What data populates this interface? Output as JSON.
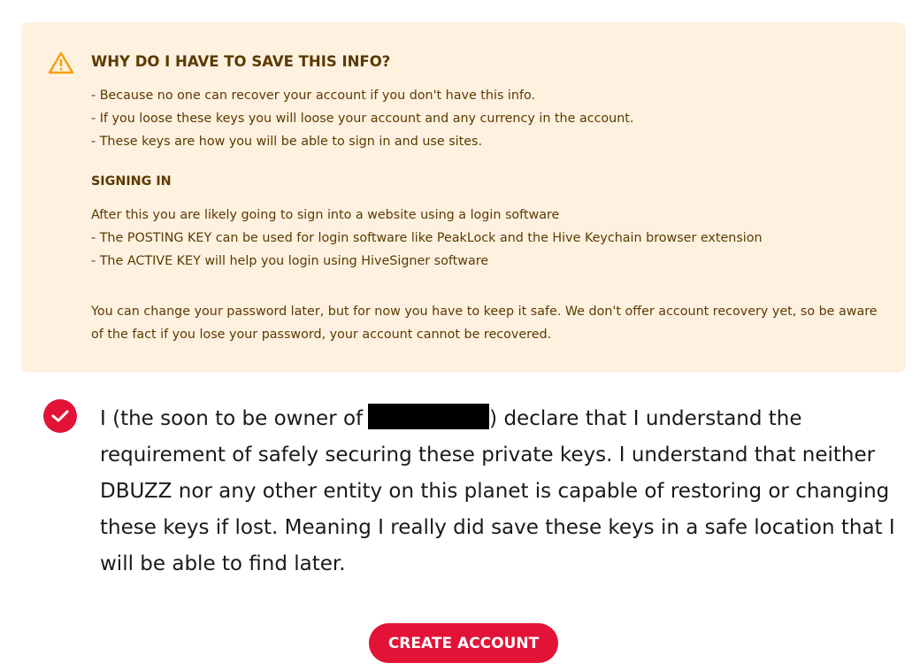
{
  "notice": {
    "title": "WHY DO I HAVE TO SAVE THIS INFO?",
    "reasons": [
      "- Because no one can recover your account if you don't have this info.",
      "- If you loose these keys you will loose your account and any currency in the account.",
      "- These keys are how you will be able to sign in and use sites."
    ],
    "signing_title": "SIGNING IN",
    "signing_lines": [
      "After this you are likely going to sign into a website using a login software",
      "- The POSTING KEY can be used for login software like PeakLock and the Hive Keychain browser extension",
      "- The ACTIVE KEY will help you login using HiveSigner software"
    ],
    "warning_paragraph": "You can change your password later, but for now you have to keep it safe. We don't offer account recovery yet, so be aware of the fact if you lose your password, your account cannot be recovered."
  },
  "declaration": {
    "checked": true,
    "prefix": "I (the soon to be owner of",
    "suffix": ") declare that I understand the requirement of safely securing these private keys. I understand that neither DBUZZ nor any other entity on this planet is capable of restoring or changing these keys if lost. Meaning I really did save these keys in a safe location that I will be able to find later."
  },
  "actions": {
    "create_label": "CREATE ACCOUNT"
  },
  "colors": {
    "notice_bg": "#fff1e0",
    "notice_text": "#5a3a00",
    "warning_icon": "#f59e0b",
    "accent": "#e31337"
  },
  "icons": {
    "warning": "warning-triangle-icon",
    "check": "checkmark-icon"
  }
}
